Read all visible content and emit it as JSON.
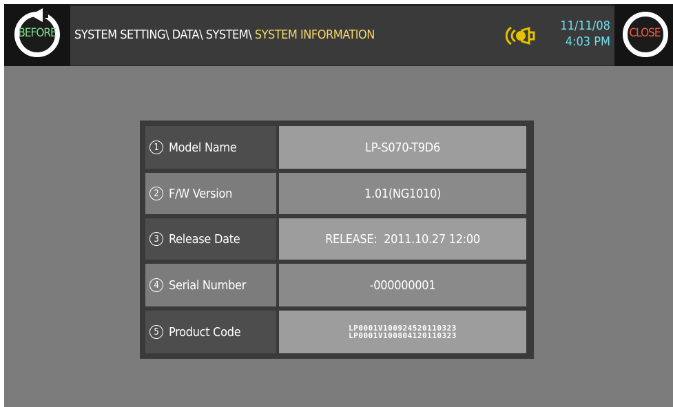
{
  "header": {
    "before_label": "BEFORE",
    "close_label": "CLOSE",
    "breadcrumb_path": "SYSTEM SETTING\\ DATA\\ SYSTEM\\ ",
    "breadcrumb_current": "SYSTEM INFORMATION",
    "date": "11/11/08",
    "time": "4:03 PM",
    "icons": {
      "before": "refresh-arrow-icon",
      "bell": "bell-icon"
    },
    "colors": {
      "before": "#7fe08a",
      "close": "#ff5a3c",
      "current": "#f5d86a",
      "datetime": "#6fe0ee",
      "bell": "#e6c200"
    }
  },
  "info": {
    "rows": [
      {
        "num": "1",
        "label": "Model Name",
        "value": "LP-S070-T9D6"
      },
      {
        "num": "2",
        "label": "F/W Version",
        "value": "1.01(NG1010)"
      },
      {
        "num": "3",
        "label": "Release Date",
        "value": "RELEASE:  2011.10.27 12:00"
      },
      {
        "num": "4",
        "label": "Serial Number",
        "value": "-000000001"
      },
      {
        "num": "5",
        "label": "Product Code",
        "value_lines": [
          "LP0001V100924520110323",
          "LP0001V100804120110323"
        ]
      }
    ]
  }
}
